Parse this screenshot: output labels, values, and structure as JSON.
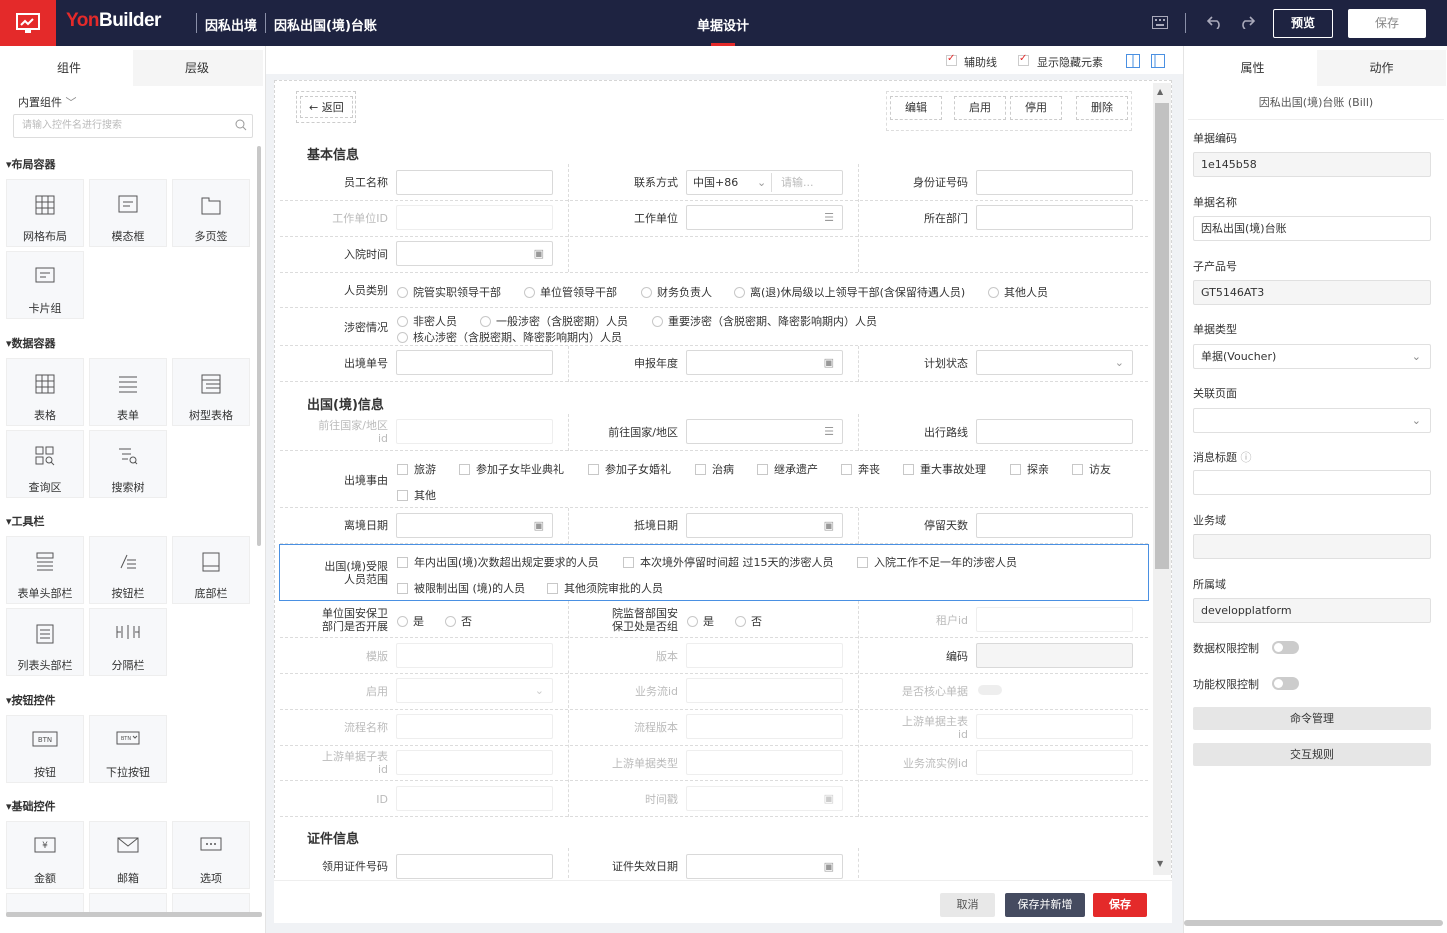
{
  "topbar": {
    "brand_a": "Yon",
    "brand_b": "Builder",
    "crumb1": "因私出境",
    "crumb2": "因私出国(境)台账",
    "title": "单据设计",
    "preview": "预览",
    "save": "保存"
  },
  "left": {
    "tab_components": "组件",
    "tab_layers": "层级",
    "builtin": "内置组件",
    "search_placeholder": "请输入控件名进行搜索",
    "sections": {
      "layout": "布局容器",
      "data": "数据容器",
      "toolbar": "工具栏",
      "button": "按钮控件",
      "basic": "基础控件"
    },
    "tiles": {
      "grid": "网格布局",
      "modal": "模态框",
      "tabs": "多页签",
      "card": "卡片组",
      "table": "表格",
      "form": "表单",
      "tree_table": "树型表格",
      "query": "查询区",
      "search_tree": "搜索树",
      "header_bar": "表单头部栏",
      "button_bar": "按钮栏",
      "footer_bar": "底部栏",
      "list_header": "列表头部栏",
      "divider_bar": "分隔栏",
      "button": "按钮",
      "dropdown_button": "下拉按钮",
      "amount": "金额",
      "email": "邮箱",
      "option": "选项"
    }
  },
  "toolbar": {
    "guides": "辅助线",
    "show_hidden": "显示隐藏元素"
  },
  "form": {
    "back": "返回",
    "edit": "编辑",
    "enable": "启用",
    "disable": "停用",
    "delete": "删除",
    "sec_basic": "基本信息",
    "sec_abroad": "出国(境)信息",
    "sec_cert": "证件信息",
    "employee_name": "员工名称",
    "contact": "联系方式",
    "contact_code": "中国+86",
    "contact_placeholder": "请输...",
    "id_number": "身份证号码",
    "work_unit_id": "工作单位ID",
    "work_unit": "工作单位",
    "department": "所在部门",
    "entry_time": "入院时间",
    "person_type": "人员类别",
    "person_type_opts": [
      "院管实职领导干部",
      "单位管领导干部",
      "财务负责人",
      "离(退)休局级以上领导干部(含保留待遇人员)",
      "其他人员"
    ],
    "secret": "涉密情况",
    "secret_opts": [
      "非密人员",
      "一般涉密（含脱密期）人员",
      "重要涉密（含脱密期、降密影响期内）人员",
      "核心涉密（含脱密期、降密影响期内）人员"
    ],
    "exit_no": "出境单号",
    "report_year": "申报年度",
    "plan_status": "计划状态",
    "dest_country_id_a": "前往国家/地区",
    "dest_country_id_b": "id",
    "dest_country": "前往国家/地区",
    "route": "出行路线",
    "reason": "出境事由",
    "reason_opts": [
      "旅游",
      "参加子女毕业典礼",
      "参加子女婚礼",
      "治病",
      "继承遗产",
      "奔丧",
      "重大事故处理",
      "探亲",
      "访友",
      "其他"
    ],
    "leave_date": "离境日期",
    "arrive_date": "抵境日期",
    "stay_days": "停留天数",
    "restricted_a": "出国(境)受限",
    "restricted_b": "人员范围",
    "restricted_opts": [
      "年内出国(境)次数超出规定要求的人员",
      "本次境外停留时间超 过15天的涉密人员",
      "入院工作不足一年的涉密人员",
      "被限制出国 (境)的人员",
      "其他须院审批的人员"
    ],
    "unit_security_a": "单位国安保卫",
    "unit_security_b": "部门是否开展",
    "dept_security_a": "院监督部国安",
    "dept_security_b": "保卫处是否组",
    "yes": "是",
    "no": "否",
    "tenant_id": "租户id",
    "template": "模版",
    "version": "版本",
    "code": "编码",
    "enabled": "启用",
    "bizflow_id": "业务流id",
    "is_core": "是否核心单据",
    "process_name": "流程名称",
    "process_version": "流程版本",
    "upstream_main_a": "上游单据主表",
    "upstream_main_b": "id",
    "upstream_sub_a": "上游单据子表",
    "upstream_sub_b": "id",
    "upstream_type": "上游单据类型",
    "bizflow_instance": "业务流实例id",
    "id": "ID",
    "timestamp": "时间戳",
    "cert_no": "领用证件号码",
    "cert_expiry": "证件失效日期",
    "cancel": "取消",
    "save_new": "保存并新增",
    "save": "保存"
  },
  "right": {
    "tab_props": "属性",
    "tab_actions": "动作",
    "subtitle": "因私出国(境)台账 (Bill)",
    "bill_code_label": "单据编码",
    "bill_code": "1e145b58",
    "bill_name_label": "单据名称",
    "bill_name": "因私出国(境)台账",
    "sub_product_label": "子产品号",
    "sub_product": "GT5146AT3",
    "bill_type_label": "单据类型",
    "bill_type": "单据(Voucher)",
    "related_page_label": "关联页面",
    "msg_title_label": "消息标题",
    "domain_label": "业务域",
    "owner_domain_label": "所属域",
    "owner_domain": "developplatform",
    "data_perm": "数据权限控制",
    "func_perm": "功能权限控制",
    "cmd_mgmt": "命令管理",
    "interaction": "交互规则"
  },
  "colors": {
    "topbar": "#1e2341",
    "brand_red": "#e42a2a",
    "save_new": "#454b60"
  }
}
